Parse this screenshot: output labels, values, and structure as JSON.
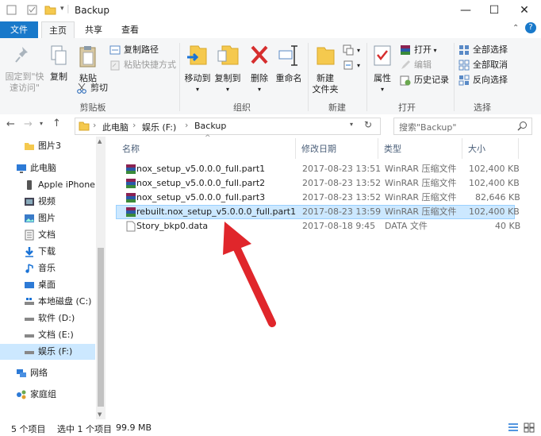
{
  "window": {
    "title": "Backup",
    "minimize": "—",
    "maximize": "☐",
    "close": "✕"
  },
  "tabs": [
    {
      "label": "文件"
    },
    {
      "label": "主页"
    },
    {
      "label": "共享"
    },
    {
      "label": "查看"
    }
  ],
  "ribbon": {
    "pin_label_1": "固定到\"快",
    "pin_label_2": "速访问\"",
    "copy_label": "复制",
    "paste_label": "粘贴",
    "copy_path": "复制路径",
    "paste_shortcut": "粘贴快捷方式",
    "cut": "剪切",
    "clipboard_group": "剪贴板",
    "move_to": "移动到",
    "copy_to": "复制到",
    "delete": "删除",
    "rename": "重命名",
    "organize_group": "组织",
    "new_folder_1": "新建",
    "new_folder_2": "文件夹",
    "new_group": "新建",
    "properties": "属性",
    "open": "打开",
    "edit": "编辑",
    "history": "历史记录",
    "open_group": "打开",
    "select_all": "全部选择",
    "select_none": "全部取消",
    "invert_selection": "反向选择",
    "select_group": "选择"
  },
  "address": {
    "crumbs": [
      "此电脑",
      "娱乐 (F:)",
      "Backup"
    ],
    "search_placeholder": "搜索\"Backup\""
  },
  "nav": [
    {
      "label": "图片3"
    },
    {
      "label": "此电脑"
    },
    {
      "label": "Apple iPhone"
    },
    {
      "label": "视频"
    },
    {
      "label": "图片"
    },
    {
      "label": "文档"
    },
    {
      "label": "下载"
    },
    {
      "label": "音乐"
    },
    {
      "label": "桌面"
    },
    {
      "label": "本地磁盘 (C:)"
    },
    {
      "label": "软件 (D:)"
    },
    {
      "label": "文档 (E:)"
    },
    {
      "label": "娱乐 (F:)"
    },
    {
      "label": "网络"
    },
    {
      "label": "家庭组"
    }
  ],
  "columns": {
    "name": "名称",
    "date": "修改日期",
    "type": "类型",
    "size": "大小"
  },
  "files": [
    {
      "name": "nox_setup_v5.0.0.0_full.part1",
      "date": "2017-08-23 13:51",
      "type": "WinRAR 压缩文件",
      "size": "102,400 KB"
    },
    {
      "name": "nox_setup_v5.0.0.0_full.part2",
      "date": "2017-08-23 13:52",
      "type": "WinRAR 压缩文件",
      "size": "102,400 KB"
    },
    {
      "name": "nox_setup_v5.0.0.0_full.part3",
      "date": "2017-08-23 13:52",
      "type": "WinRAR 压缩文件",
      "size": "82,646 KB"
    },
    {
      "name": "rebuilt.nox_setup_v5.0.0.0_full.part1",
      "date": "2017-08-23 13:59",
      "type": "WinRAR 压缩文件",
      "size": "102,400 KB"
    },
    {
      "name": "Story_bkp0.data",
      "date": "2017-08-18 9:45",
      "type": "DATA 文件",
      "size": "40 KB"
    }
  ],
  "status": {
    "count": "5 个项目",
    "selection": "选中 1 个项目",
    "size": "99.9 MB"
  },
  "colors": {
    "accent": "#1979ca",
    "selection": "#cce8ff",
    "arrow": "#e0262b"
  }
}
